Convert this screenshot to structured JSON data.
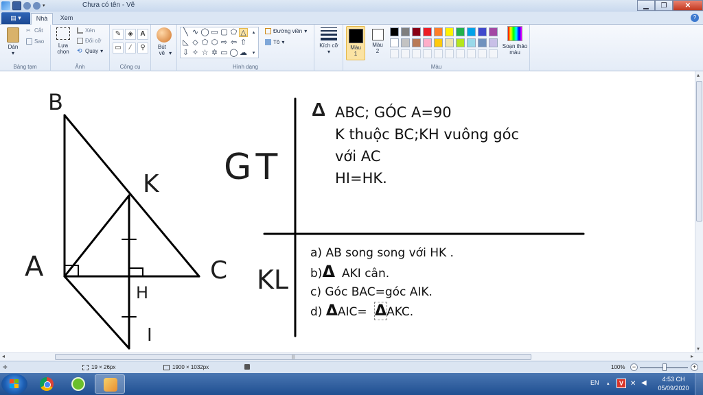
{
  "window": {
    "title": "Chưa có tên - Vẽ",
    "min": "▁",
    "max": "❐",
    "close": "✕",
    "help": "?"
  },
  "tabs": {
    "file": "▤ ▾",
    "home": "Nhà",
    "view": "Xem"
  },
  "ribbon": {
    "clipboard": {
      "label": "Bảng tạm",
      "paste": "Dán",
      "paste_arrow": "▾",
      "cut": "Cắt",
      "copy": "Sao"
    },
    "image": {
      "label": "Ảnh",
      "select": "Lựa chọn",
      "select_arrow": "▾",
      "crop": "Xén",
      "resize": "Đổi cỡ",
      "rotate": "Quay"
    },
    "tools": {
      "label": "Công cụ",
      "brushes": "Bút vẽ",
      "brushes_arrow": "▾"
    },
    "shapes": {
      "label": "Hình dạng",
      "outline": "Đường viền",
      "fill": "Tô"
    },
    "size": {
      "label": "Kích cỡ"
    },
    "colors": {
      "label": "Màu",
      "color1": "Màu 1",
      "color2": "Màu 2",
      "edit": "Soạn thảo màu",
      "color1_value": "#000000",
      "color2_value": "#ffffff",
      "palette_row1": [
        "#000000",
        "#7f7f7f",
        "#880015",
        "#ed1c24",
        "#ff7f27",
        "#fff200",
        "#22b14c",
        "#00a2e8",
        "#3f48cc",
        "#a349a4"
      ],
      "palette_row2": [
        "#ffffff",
        "#c3c3c3",
        "#b97a57",
        "#ffaec9",
        "#ffc90e",
        "#efe4b0",
        "#b5e61d",
        "#99d9ea",
        "#7092be",
        "#c8bfe7"
      ]
    }
  },
  "drawing": {
    "label_B": "B",
    "label_K": "K",
    "label_A": "A",
    "label_C": "C",
    "label_H": "H",
    "label_I": "I",
    "label_GT": "GT",
    "label_KL": "KL",
    "triangle_sym": "Δ",
    "gt_lines": [
      "ABC; GÓC A=90",
      "K thuộc BC;KH vuông góc",
      "với AC",
      "HI=HK."
    ],
    "kl_lines": [
      "a) AB song song với HK .",
      "AKI cân.",
      "c) Góc BAC=góc AIK.",
      "AIC=",
      "AKC."
    ],
    "kl_b_prefix": "b)",
    "kl_d_prefix": "d)"
  },
  "status": {
    "cursor_size": "19 × 26px",
    "image_size": "1900 × 1032px",
    "zoom": "100%",
    "zoom_minus": "−",
    "zoom_plus": "+"
  },
  "taskbar": {
    "lang": "EN",
    "time": "4:53 CH",
    "date": "05/09/2020"
  },
  "scroll": {
    "grip": "|||",
    "left": "◂",
    "right": "▸",
    "up": "▴",
    "down": "▾"
  }
}
